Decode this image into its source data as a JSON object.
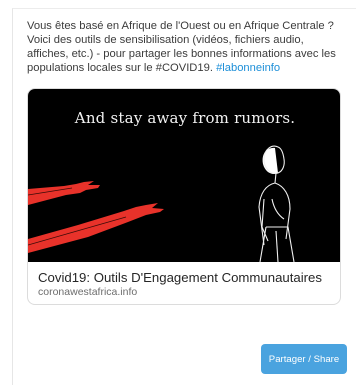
{
  "post": {
    "text": "Vous êtes basé en Afrique de l'Ouest ou en Afrique Centrale ? Voici des outils de sensibilisation (vidéos, fichiers audio, affiches, etc.) - pour partager les bonnes informations avec les populations locales sur le #COVID19.",
    "hashtag": "#labonneinfo"
  },
  "link_preview": {
    "image_caption": "And stay away from rumors.",
    "title": "Covid19: Outils D'Engagement Communautaires",
    "domain": "coronawestafrica.info"
  },
  "actions": {
    "share_label": "Partager / Share"
  },
  "colors": {
    "hashtag": "#1d8fd8",
    "share_button": "#4aa3df",
    "hands": "#e8322a"
  },
  "icons": {
    "illustration": "hands-reaching-woman-illustration"
  }
}
